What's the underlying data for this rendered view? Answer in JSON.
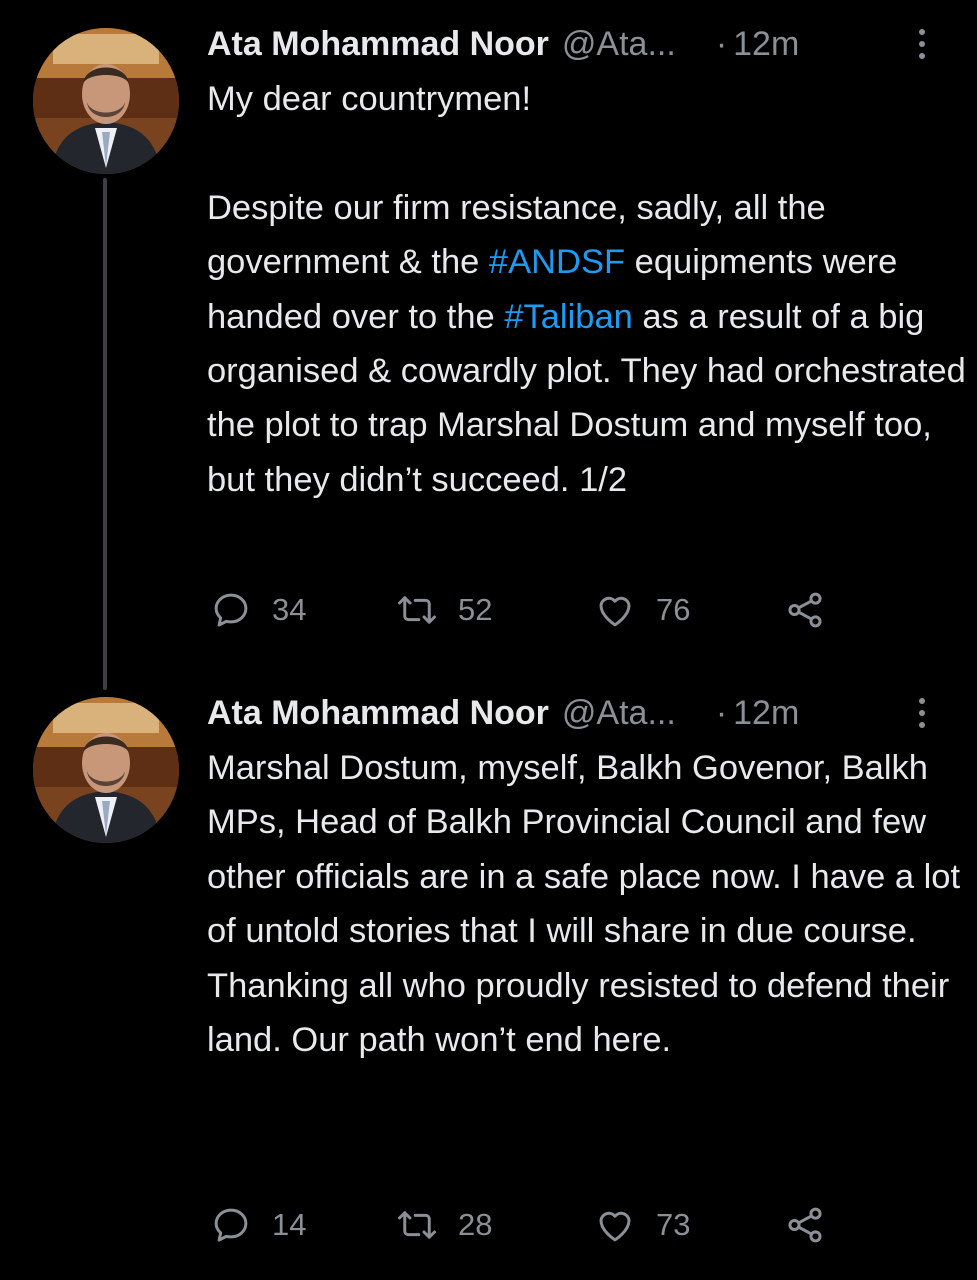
{
  "tweets": [
    {
      "author_name": "Ata Mohammad Noor",
      "handle": "@Ata...",
      "dot": "·",
      "time": "12m",
      "text_before_1": "My dear countrymen!\n\nDespite our firm resistance, sadly, all the government & the ",
      "hashtag_1": "#ANDSF",
      "text_between": " equipments were handed over to the ",
      "hashtag_2": "#Taliban",
      "text_after": " as a result of a big organised & cowardly plot. They had orchestrated the plot to trap Marshal Dostum and myself too, but they didn’t succeed. 1/2",
      "replies": "34",
      "retweets": "52",
      "likes": "76"
    },
    {
      "author_name": "Ata Mohammad Noor",
      "handle": "@Ata...",
      "dot": "·",
      "time": "12m",
      "text": "Marshal Dostum, myself, Balkh Govenor, Balkh MPs, Head of Balkh Provincial Council and few other officials are in a safe place now. I have a lot of untold stories that I will share in due course. Thanking all who proudly resisted to defend their land. Our path won’t end here.",
      "replies": "14",
      "retweets": "28",
      "likes": "73"
    }
  ],
  "colors": {
    "background": "#000000",
    "text": "#e7e9ea",
    "secondary": "#8b9096",
    "hashtag": "#1d9bf0",
    "thread_line": "#3c3f43"
  },
  "icons": [
    "reply-icon",
    "retweet-icon",
    "like-icon",
    "share-icon",
    "more-options-icon"
  ]
}
